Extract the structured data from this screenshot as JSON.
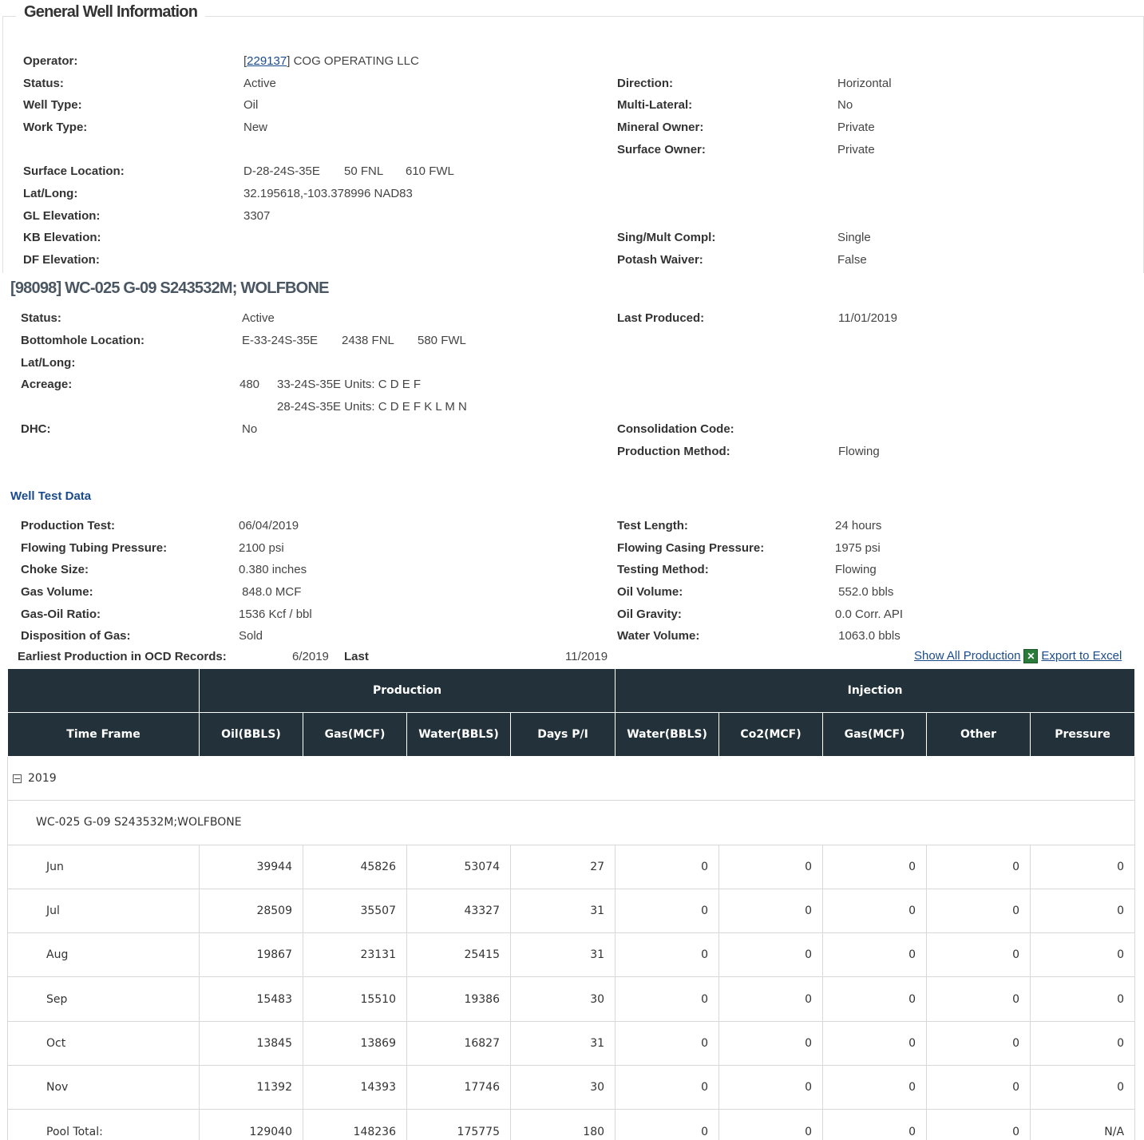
{
  "general": {
    "title": "General Well Information",
    "operator": {
      "label": "Operator:",
      "id": "229137",
      "name": "COG OPERATING LLC"
    },
    "left_rows": [
      {
        "label": "Status:",
        "value": "Active"
      },
      {
        "label": "Well Type:",
        "value": "Oil"
      },
      {
        "label": "Work Type:",
        "value": "New"
      }
    ],
    "right_rows": [
      {
        "label": "Direction:",
        "value": "Horizontal"
      },
      {
        "label": "Multi-Lateral:",
        "value": "No"
      },
      {
        "label": "Mineral Owner:",
        "value": "Private"
      },
      {
        "label": "Surface Owner:",
        "value": "Private"
      }
    ],
    "surface_location": {
      "label": "Surface Location:",
      "value": "D-28-24S-35E",
      "fnl": "50 FNL",
      "fwl": "610 FWL"
    },
    "lat_long": {
      "label": "Lat/Long:",
      "value": "32.195618,-103.378996 NAD83"
    },
    "gl_elevation": {
      "label": "GL Elevation:",
      "value": "3307"
    },
    "kb_elevation": {
      "label": "KB Elevation:",
      "value": ""
    },
    "df_elevation": {
      "label": "DF Elevation:",
      "value": ""
    },
    "sing_mult": {
      "label": "Sing/Mult Compl:",
      "value": "Single"
    },
    "potash": {
      "label": "Potash Waiver:",
      "value": "False"
    }
  },
  "pool": {
    "title": "[98098]  WC-025 G-09 S243532M; WOLFBONE",
    "status": {
      "label": "Status:",
      "value": "Active"
    },
    "last_produced": {
      "label": "Last Produced:",
      "value": "11/01/2019"
    },
    "bottomhole": {
      "label": "Bottomhole Location:",
      "value": "E-33-24S-35E",
      "fnl": "2438 FNL",
      "fwl": "580 FWL"
    },
    "lat_long": {
      "label": "Lat/Long:",
      "value": ""
    },
    "acreage": {
      "label": "Acreage:",
      "value": "480",
      "units1": "33-24S-35E Units: C D E F",
      "units2": "28-24S-35E Units: C D E F K L M N"
    },
    "dhc": {
      "label": "DHC:",
      "value": "No"
    },
    "consolidation": {
      "label": "Consolidation Code:",
      "value": ""
    },
    "production_method": {
      "label": "Production Method:",
      "value": "Flowing"
    }
  },
  "well_test": {
    "title": "Well Test Data",
    "left_rows": [
      {
        "label": "Production Test:",
        "value": "06/04/2019"
      },
      {
        "label": "Flowing Tubing Pressure:",
        "value": "2100 psi"
      },
      {
        "label": "Choke Size:",
        "value": "0.380 inches"
      },
      {
        "label": "Gas Volume:",
        "value": " 848.0 MCF"
      },
      {
        "label": "Gas-Oil Ratio:",
        "value": "1536 Kcf / bbl"
      },
      {
        "label": "Disposition of Gas:",
        "value": "Sold"
      }
    ],
    "right_rows": [
      {
        "label": "Test Length:",
        "value": "24 hours"
      },
      {
        "label": "Flowing Casing Pressure:",
        "value": "1975 psi"
      },
      {
        "label": "Testing Method:",
        "value": "Flowing"
      },
      {
        "label": "Oil Volume:",
        "value": " 552.0 bbls"
      },
      {
        "label": "Oil Gravity:",
        "value": "0.0 Corr. API"
      },
      {
        "label": "Water Volume:",
        "value": " 1063.0 bbls"
      }
    ]
  },
  "records": {
    "earliest_label": "Earliest Production in OCD Records:",
    "earliest_value": "6/2019",
    "last_label": "Last",
    "last_value": "11/2019",
    "show_all": "Show All Production",
    "export": "Export to Excel"
  },
  "table": {
    "group_production": "Production",
    "group_injection": "Injection",
    "columns": [
      "Time Frame",
      "Oil(BBLS)",
      "Gas(MCF)",
      "Water(BBLS)",
      "Days P/I",
      "Water(BBLS)",
      "Co2(MCF)",
      "Gas(MCF)",
      "Other",
      "Pressure"
    ],
    "year": "2019",
    "pool_name": "WC-025 G-09 S243532M;WOLFBONE",
    "rows": [
      [
        "Jun",
        "39944",
        "45826",
        "53074",
        "27",
        "0",
        "0",
        "0",
        "0",
        "0"
      ],
      [
        "Jul",
        "28509",
        "35507",
        "43327",
        "31",
        "0",
        "0",
        "0",
        "0",
        "0"
      ],
      [
        "Aug",
        "19867",
        "23131",
        "25415",
        "31",
        "0",
        "0",
        "0",
        "0",
        "0"
      ],
      [
        "Sep",
        "15483",
        "15510",
        "19386",
        "30",
        "0",
        "0",
        "0",
        "0",
        "0"
      ],
      [
        "Oct",
        "13845",
        "13869",
        "16827",
        "31",
        "0",
        "0",
        "0",
        "0",
        "0"
      ],
      [
        "Nov",
        "11392",
        "14393",
        "17746",
        "30",
        "0",
        "0",
        "0",
        "0",
        "0"
      ],
      [
        "Pool Total:",
        "129040",
        "148236",
        "175775",
        "180",
        "0",
        "0",
        "0",
        "0",
        "N/A"
      ]
    ]
  }
}
